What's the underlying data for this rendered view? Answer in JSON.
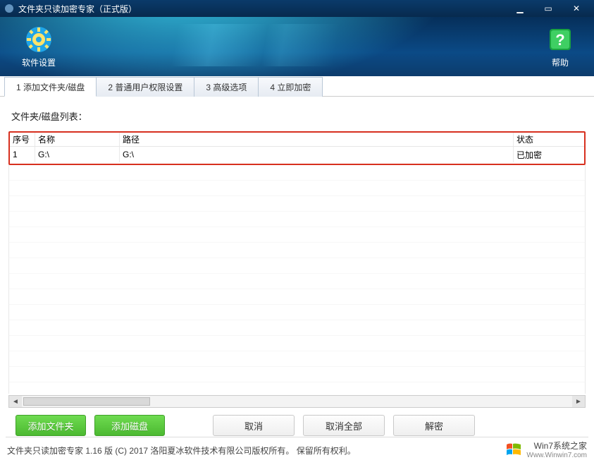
{
  "window": {
    "title": "文件夹只读加密专家（正式版）"
  },
  "header": {
    "settings_label": "软件设置",
    "help_label": "帮助"
  },
  "tabs": [
    {
      "label": "1 添加文件夹/磁盘",
      "active": true
    },
    {
      "label": "2 普通用户权限设置",
      "active": false
    },
    {
      "label": "3 高级选项",
      "active": false
    },
    {
      "label": "4 立即加密",
      "active": false
    }
  ],
  "list_label": "文件夹/磁盘列表：",
  "columns": {
    "index": "序号",
    "name": "名称",
    "path": "路径",
    "status": "状态"
  },
  "rows": [
    {
      "index": "1",
      "name": "G:\\",
      "path": "G:\\",
      "status": "已加密"
    }
  ],
  "buttons": {
    "add_folder": "添加文件夹",
    "add_disk": "添加磁盘",
    "cancel": "取消",
    "cancel_all": "取消全部",
    "decrypt": "解密"
  },
  "footer": {
    "text": "文件夹只读加密专家 1.16 版 (C) 2017 洛阳夏冰软件技术有限公司版权所有。 保留所有权利。",
    "brand_main_prefix": "W",
    "brand_main_rest": "in7系统之家",
    "brand_sub": "Www.Winwin7.com"
  }
}
